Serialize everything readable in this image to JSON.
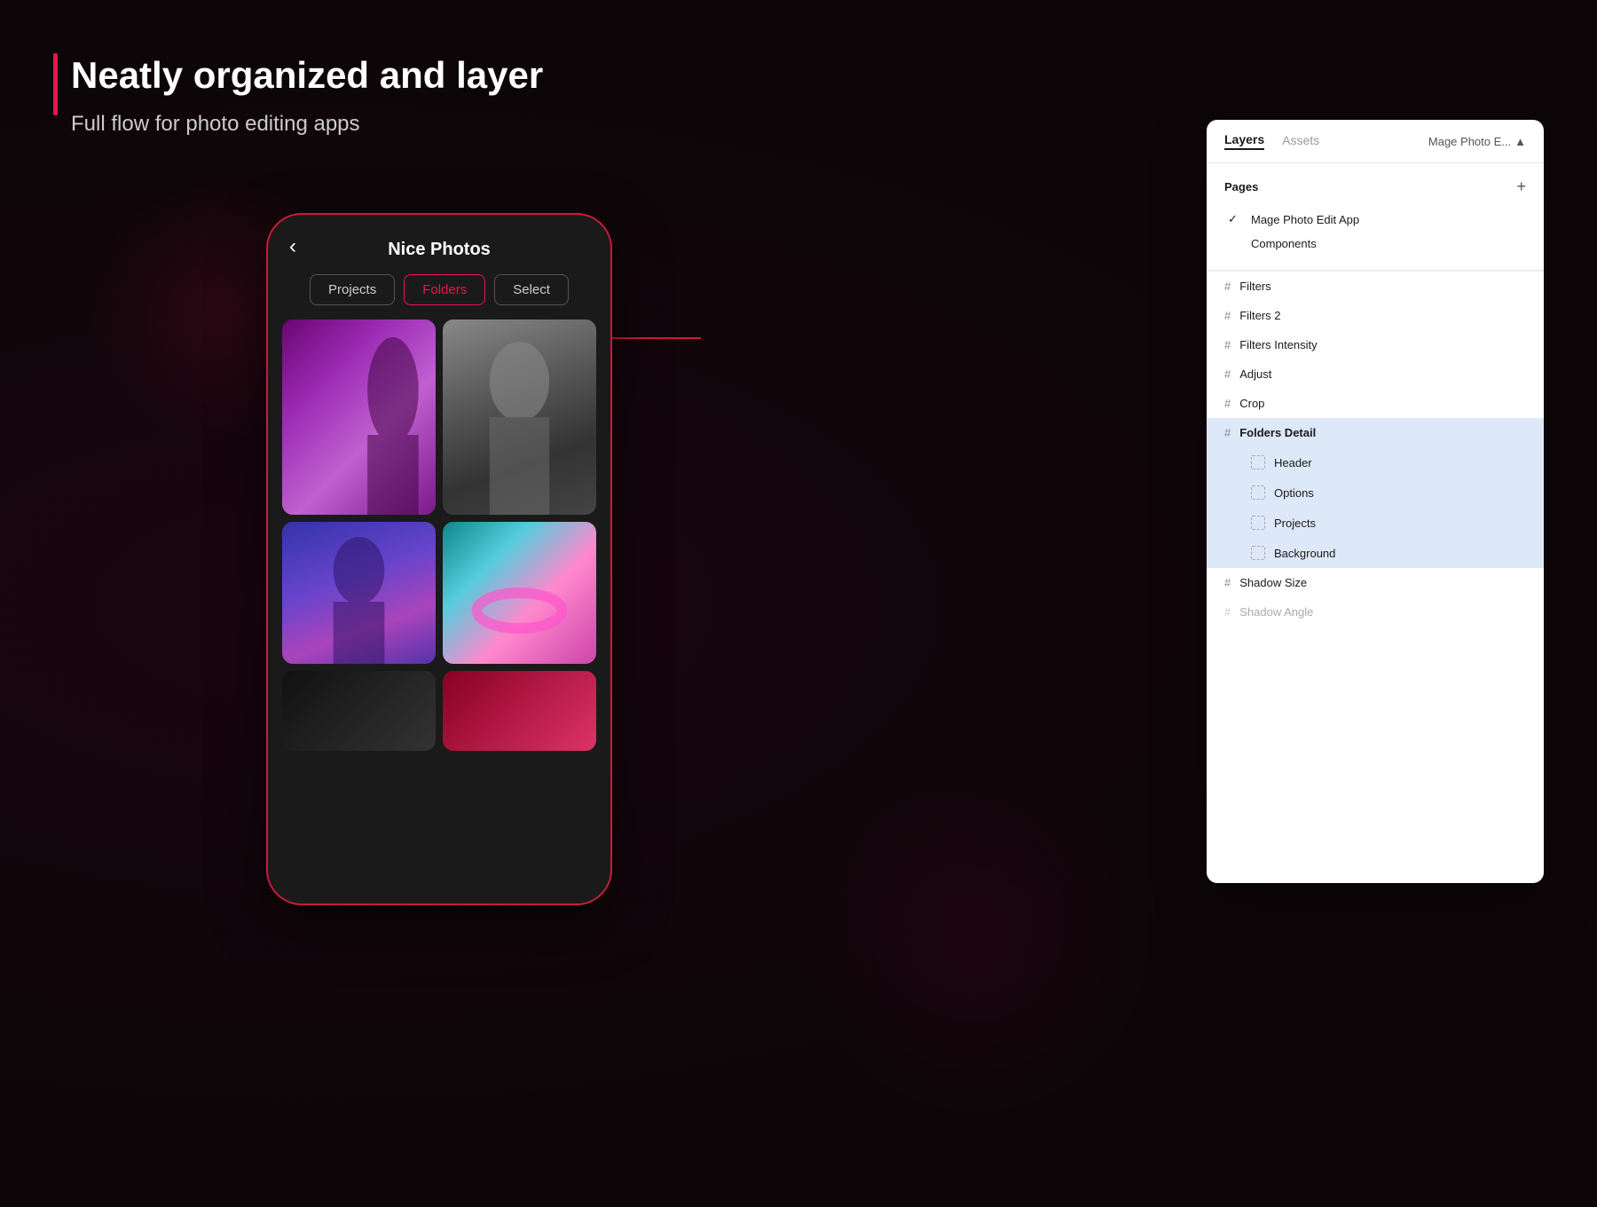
{
  "headline": "Neatly organized and layer",
  "subheadline": "Full flow for photo editing apps",
  "phone": {
    "back_icon": "‹",
    "title": "Nice Photos",
    "tabs": [
      {
        "label": "Projects",
        "state": "inactive"
      },
      {
        "label": "Folders",
        "state": "active"
      },
      {
        "label": "Select",
        "state": "inactive"
      }
    ]
  },
  "figma": {
    "tabs": [
      {
        "label": "Layers",
        "state": "active"
      },
      {
        "label": "Assets",
        "state": "muted"
      },
      {
        "label": "Mage Photo E...",
        "state": "dropdown"
      }
    ],
    "dropdown_icon": "▲",
    "pages_section": {
      "title": "Pages",
      "add_icon": "+",
      "items": [
        {
          "label": "Mage Photo Edit App",
          "checked": true
        },
        {
          "label": "Components",
          "checked": false
        }
      ]
    },
    "layers": [
      {
        "label": "Filters",
        "type": "hash",
        "selected": false,
        "muted": false,
        "indent": "none"
      },
      {
        "label": "Filters 2",
        "type": "hash",
        "selected": false,
        "muted": false,
        "indent": "none"
      },
      {
        "label": "Filters Intensity",
        "type": "hash",
        "selected": false,
        "muted": false,
        "indent": "none"
      },
      {
        "label": "Adjust",
        "type": "hash",
        "selected": false,
        "muted": false,
        "indent": "none"
      },
      {
        "label": "Crop",
        "type": "hash",
        "selected": false,
        "muted": false,
        "indent": "none"
      },
      {
        "label": "Folders Detail",
        "type": "hash",
        "selected": true,
        "muted": false,
        "indent": "none"
      },
      {
        "label": "Header",
        "type": "dashed",
        "selected": true,
        "muted": false,
        "indent": "sub"
      },
      {
        "label": "Options",
        "type": "dashed",
        "selected": true,
        "muted": false,
        "indent": "sub"
      },
      {
        "label": "Projects",
        "type": "dashed",
        "selected": true,
        "muted": false,
        "indent": "sub"
      },
      {
        "label": "Background",
        "type": "dashed",
        "selected": true,
        "muted": false,
        "indent": "sub"
      },
      {
        "label": "Shadow Size",
        "type": "hash",
        "selected": false,
        "muted": false,
        "indent": "none"
      },
      {
        "label": "Shadow Angle",
        "type": "hash",
        "selected": false,
        "muted": true,
        "indent": "none"
      }
    ]
  },
  "colors": {
    "accent": "#e8174a",
    "panel_bg": "#ffffff",
    "selected_bg": "#dde8f8",
    "dark_bg": "#0d0608"
  }
}
